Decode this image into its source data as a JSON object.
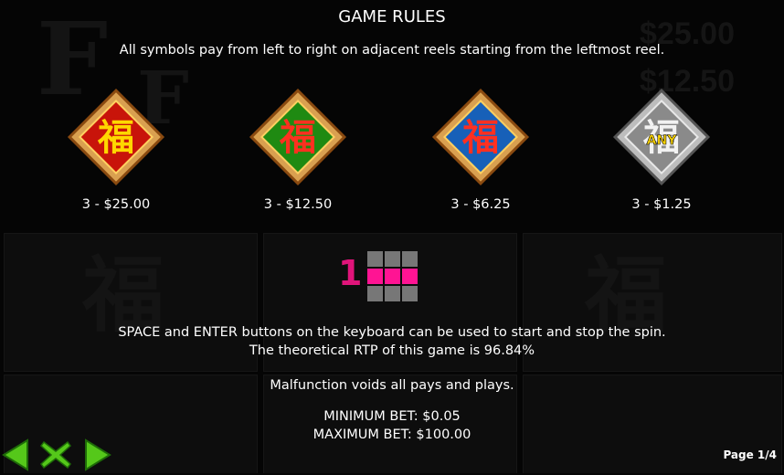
{
  "title": "GAME RULES",
  "subtitle": "All symbols pay from left to right on adjacent reels starting from the leftmost reel.",
  "symbols": [
    {
      "name": "red-fu-symbol",
      "glyph": "福",
      "color": "#c8140a",
      "payout": "3 - $25.00"
    },
    {
      "name": "green-fu-symbol",
      "glyph": "福",
      "color": "#1f8a12",
      "payout": "3 - $12.50"
    },
    {
      "name": "blue-fu-symbol",
      "glyph": "福",
      "color": "#1760b8",
      "payout": "3 - $6.25"
    },
    {
      "name": "silver-any-symbol",
      "glyph": "福",
      "label": "ANY",
      "color": "#8a8a8a",
      "payout": "3 - $1.25"
    }
  ],
  "paylines": {
    "number": "1",
    "active_row": 2
  },
  "info": {
    "keyboard": "SPACE and ENTER buttons on the keyboard can be used to start and stop the spin.",
    "rtp": "The theoretical RTP of this game is 96.84%",
    "malfunction": "Malfunction voids all pays and plays.",
    "min_bet": "MINIMUM BET: $0.05",
    "max_bet": "MAXIMUM BET: $100.00"
  },
  "page_indicator": "Page 1/4",
  "nav": {
    "prev_icon": "arrow-left-icon",
    "close_icon": "close-icon",
    "next_icon": "arrow-right-icon"
  }
}
